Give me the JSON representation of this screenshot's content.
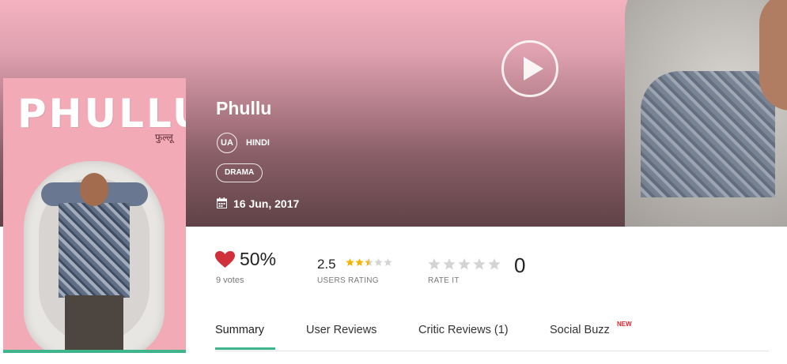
{
  "movie": {
    "title": "Phullu",
    "certificate": "UA",
    "language": "HINDI",
    "genre": "DRAMA",
    "release_date": "16 Jun, 2017"
  },
  "poster": {
    "title_text": "PHULLU",
    "subtitle_text": "फुल्लू"
  },
  "likes": {
    "percent": "50%",
    "votes": "9 votes"
  },
  "users_rating": {
    "value": "2.5",
    "label": "USERS RATING",
    "stars_value": 2.5,
    "stars_max": 5
  },
  "rate_it": {
    "label": "RATE IT",
    "count": "0",
    "stars_max": 5
  },
  "tabs": [
    {
      "label": "Summary",
      "active": true
    },
    {
      "label": "User Reviews"
    },
    {
      "label": "Critic Reviews (1)"
    },
    {
      "label": "Social Buzz",
      "badge": "NEW"
    }
  ],
  "colors": {
    "accent_green": "#3fb58d",
    "heart_red": "#d0303a",
    "star_gold": "#f5b400",
    "star_grey": "#d4d4d4",
    "badge_red": "#e0242b"
  },
  "icons": {
    "play": "play-icon",
    "like": "heart-icon",
    "calendar": "calendar-icon"
  }
}
